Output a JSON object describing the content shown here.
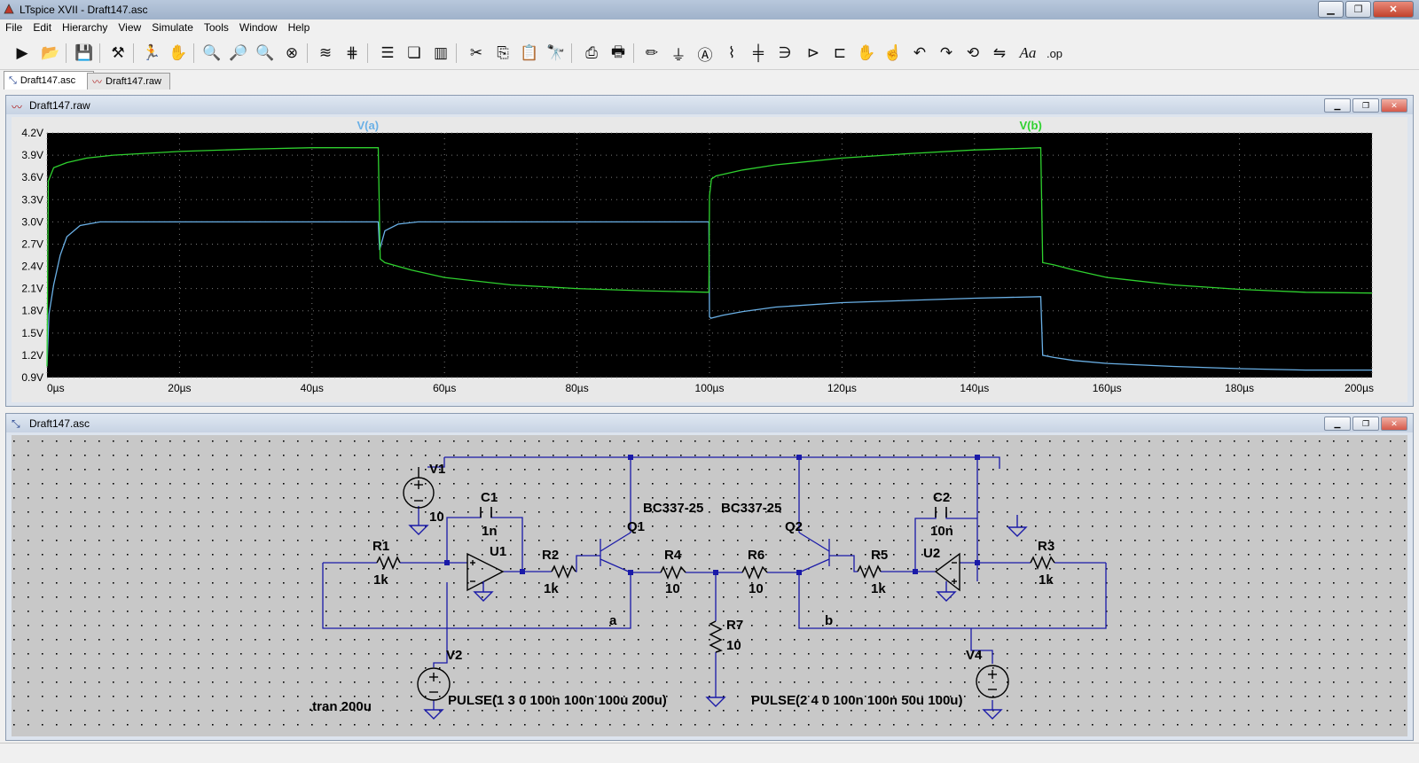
{
  "window": {
    "title": "LTspice XVII - Draft147.asc"
  },
  "menu": [
    "File",
    "Edit",
    "Hierarchy",
    "View",
    "Simulate",
    "Tools",
    "Window",
    "Help"
  ],
  "toolbar_icons": [
    "run-icon",
    "open-icon",
    "save-icon",
    "control-panel-icon",
    "halt-icon",
    "pan-icon",
    "zoom-in-icon",
    "zoom-area-icon",
    "zoom-out-icon",
    "zoom-fit-icon",
    "autorange-icon",
    "autorange-y-icon",
    "tile-horizontal-icon",
    "cascade-icon",
    "tile-vertical-icon",
    "cut-icon",
    "copy-icon",
    "paste-icon",
    "find-icon",
    "print-icon",
    "print-setup-icon",
    "draw-wire-icon",
    "ground-icon",
    "label-net-icon",
    "resistor-icon",
    "capacitor-icon",
    "inductor-icon",
    "diode-icon",
    "component-icon",
    "move-icon",
    "drag-icon",
    "undo-icon",
    "redo-icon",
    "rotate-icon",
    "mirror-icon",
    "text-icon",
    "spice-directive-icon"
  ],
  "tabs": [
    {
      "label": "Draft147.asc",
      "icon": "schematic-icon"
    },
    {
      "label": "Draft147.raw",
      "icon": "waveform-icon"
    }
  ],
  "plot_window": {
    "title": "Draft147.raw"
  },
  "schematic_window": {
    "title": "Draft147.asc"
  },
  "chart_data": {
    "type": "line",
    "background": "#000000",
    "grid": true,
    "xlim": [
      0,
      200
    ],
    "ylim": [
      0.9,
      4.2
    ],
    "x_unit": "µs",
    "x_ticks": [
      "0µs",
      "20µs",
      "40µs",
      "60µs",
      "80µs",
      "100µs",
      "120µs",
      "140µs",
      "160µs",
      "180µs",
      "200µs"
    ],
    "y_ticks": [
      "4.2V",
      "3.9V",
      "3.6V",
      "3.3V",
      "3.0V",
      "2.7V",
      "2.4V",
      "2.1V",
      "1.8V",
      "1.5V",
      "1.2V",
      "0.9V"
    ],
    "series": [
      {
        "name": "V(a)",
        "color": "#6ab0e6",
        "x": [
          0,
          0.3,
          1,
          2,
          3,
          5,
          8,
          12,
          20,
          40,
          50,
          50.2,
          51,
          53,
          56,
          60,
          80,
          99.9,
          100,
          100.2,
          102,
          105,
          110,
          120,
          140,
          149.9,
          150,
          150.3,
          152,
          155,
          160,
          170,
          180,
          190,
          200
        ],
        "y": [
          1.05,
          1.75,
          2.15,
          2.55,
          2.8,
          2.95,
          3.0,
          3.0,
          3.0,
          3.0,
          3.0,
          2.62,
          2.88,
          2.97,
          3.0,
          3.0,
          3.0,
          3.0,
          1.72,
          1.7,
          1.74,
          1.79,
          1.85,
          1.91,
          1.97,
          1.99,
          1.99,
          1.2,
          1.17,
          1.13,
          1.09,
          1.05,
          1.02,
          1.0,
          1.0
        ]
      },
      {
        "name": "V(b)",
        "color": "#2fd12f",
        "x": [
          0,
          0.2,
          1,
          3,
          6,
          10,
          20,
          30,
          40,
          50,
          50.3,
          51,
          55,
          60,
          70,
          80,
          90,
          99.9,
          100,
          100.3,
          101,
          105,
          110,
          120,
          130,
          140,
          150,
          150.3,
          152,
          155,
          160,
          170,
          180,
          190,
          200
        ],
        "y": [
          1.05,
          3.55,
          3.73,
          3.8,
          3.86,
          3.9,
          3.95,
          3.98,
          4.0,
          4.0,
          2.5,
          2.45,
          2.35,
          2.25,
          2.15,
          2.1,
          2.07,
          2.05,
          3.35,
          3.58,
          3.62,
          3.7,
          3.77,
          3.86,
          3.92,
          3.97,
          4.0,
          2.45,
          2.42,
          2.35,
          2.25,
          2.15,
          2.09,
          2.05,
          2.04
        ]
      }
    ]
  },
  "schematic": {
    "labels": {
      "V1": "V1",
      "V2": "V2",
      "V4": "V4",
      "C1": "C1",
      "C1_val": "1n",
      "C2": "C2",
      "C2_val": "10n",
      "U1": "U1",
      "U2": "U2",
      "R1": "R1",
      "R1_val": "1k",
      "R2": "R2",
      "R2_val": "1k",
      "R3": "R3",
      "R3_val": "1k",
      "R4": "R4",
      "R4_val": "10",
      "R5": "R5",
      "R5_val": "1k",
      "R6": "R6",
      "R6_val": "10",
      "R7": "R7",
      "R7_val": "10",
      "Q1": "Q1",
      "Q1_model": "BC337-25",
      "Q2": "Q2",
      "Q2_model": "BC337-25",
      "V1_val": "10",
      "net_a": "a",
      "net_b": "b",
      "tran": ".tran 200u",
      "V2_pulse": "PULSE(1 3 0 100n 100n 100u 200u)",
      "V4_pulse": "PULSE(2 4 0 100n 100n 50u 100u)"
    }
  }
}
